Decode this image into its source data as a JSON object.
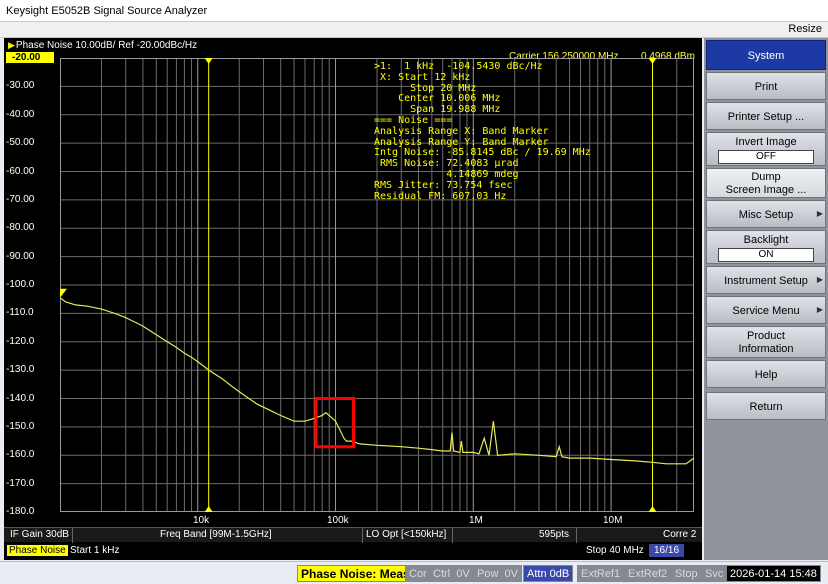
{
  "window": {
    "title": "Keysight E5052B Signal Source Analyzer",
    "resize_label": "Resize"
  },
  "trace_header": {
    "title": "Phase Noise 10.00dB/ Ref -20.00dBc/Hz",
    "carrier": "Carrier 156.250000 MHz",
    "power": "0.4968 dBm"
  },
  "y_axis": {
    "labels": [
      "-20.00",
      "-30.00",
      "-40.00",
      "-50.00",
      "-60.00",
      "-70.00",
      "-80.00",
      "-90.00",
      "-100.0",
      "-110.0",
      "-120.0",
      "-130.0",
      "-140.0",
      "-150.0",
      "-160.0",
      "-170.0",
      "-180.0"
    ]
  },
  "x_axis": {
    "labels": [
      "10k",
      "100k",
      "1M",
      "10M"
    ]
  },
  "marker_readout": [
    ">1:  1 kHz  -104.5430 dBc/Hz",
    " X: Start 12 kHz",
    "      Stop 20 MHz",
    "    Center 10.006 MHz",
    "      Span 19.988 MHz",
    "=== Noise ===",
    "Analysis Range X: Band Marker",
    "Analysis Range Y: Band Marker",
    "Intg Noise: -85.8145 dBc / 19.69 MHz",
    " RMS Noise: 72.4083 µrad",
    "            4.14869 mdeg",
    "RMS Jitter: 73.754 fsec",
    "Residual FM: 607.03 Hz"
  ],
  "status_row": {
    "if_gain": "IF Gain 30dB",
    "freq_band": "Freq Band [99M-1.5GHz]",
    "lo_opt": "LO Opt [<150kHz]",
    "points": "595pts",
    "corre": "Corre 2"
  },
  "bottom_row": {
    "mode": "Phase Noise",
    "start": "Start 1 kHz",
    "stop": "Stop 40 MHz",
    "count": "16/16"
  },
  "softkeys": {
    "header": "System",
    "print": "Print",
    "printer_setup": "Printer Setup ...",
    "invert_image": "Invert Image",
    "invert_image_value": "OFF",
    "dump_line1": "Dump",
    "dump_line2": "Screen Image ...",
    "misc_setup": "Misc Setup",
    "backlight": "Backlight",
    "backlight_value": "ON",
    "instrument_setup": "Instrument Setup",
    "service_menu": "Service Menu",
    "product_info_line1": "Product",
    "product_info_line2": "Information",
    "help": "Help",
    "return": "Return"
  },
  "footer": {
    "meas": "Phase Noise: Meas",
    "cor": "Cor",
    "ctrl": "Ctrl",
    "ctrl_val": "0V",
    "pow": "Pow",
    "pow_val": "0V",
    "attn": "Attn 0dB",
    "extref1": "ExtRef1",
    "extref2": "ExtRef2",
    "stop": "Stop",
    "svc": "Svc",
    "datetime": "2026-01-14 15:48"
  },
  "colors": {
    "trace": "#e8e85a",
    "grid": "#6b6b6b",
    "marker_line": "#ffff00",
    "highlight_box": "#ff0000",
    "softkey_header": "#1d3aa4"
  },
  "chart_data": {
    "type": "line",
    "title": "Phase Noise 10.00dB/ Ref -20.00dBc/Hz",
    "xlabel": "",
    "ylabel": "",
    "x_scale": "log",
    "xlim": [
      1000,
      40000000
    ],
    "ylim": [
      -180,
      -20
    ],
    "band_markers_hz": [
      12000,
      20000000
    ],
    "series": [
      {
        "x": [
          1000,
          1100,
          1300,
          1600,
          2000,
          2500,
          3000,
          4000,
          5000,
          6000,
          7000,
          8000,
          9000,
          10000,
          12000,
          15000,
          18000,
          22000,
          27000,
          33000,
          40000,
          50000,
          60000,
          70000,
          80000,
          85000,
          90000,
          95000,
          100000,
          105000,
          110000,
          115000,
          120000,
          130000,
          150000,
          200000,
          300000,
          400000,
          500000,
          600000,
          680000,
          700000,
          720000,
          800000,
          820000,
          840000,
          1000000,
          1100000,
          1200000,
          1300000,
          1400000,
          1500000,
          2000000,
          3000000,
          4000000,
          4200000,
          4400000,
          5000000,
          7000000,
          10000000,
          15000000,
          20000000,
          25000000,
          30000000,
          35000000,
          40000000
        ],
        "y": [
          -104.5,
          -106,
          -107,
          -107.5,
          -108.5,
          -110,
          -111.5,
          -114.5,
          -117.5,
          -120,
          -122,
          -124,
          -125.5,
          -127,
          -130,
          -133,
          -136,
          -139,
          -142,
          -144,
          -146,
          -148,
          -148,
          -147,
          -146,
          -145,
          -146,
          -147,
          -148,
          -150,
          -152,
          -154,
          -155,
          -155,
          -156,
          -156.5,
          -157,
          -157.5,
          -158,
          -158.5,
          -158.5,
          -152,
          -158.5,
          -159,
          -155,
          -159,
          -159,
          -159.5,
          -154,
          -160,
          -148,
          -160,
          -159.5,
          -160,
          -160.5,
          -157,
          -160.5,
          -161,
          -161,
          -161.5,
          -162,
          -162.5,
          -163,
          -163,
          -163,
          -161
        ]
      }
    ]
  }
}
